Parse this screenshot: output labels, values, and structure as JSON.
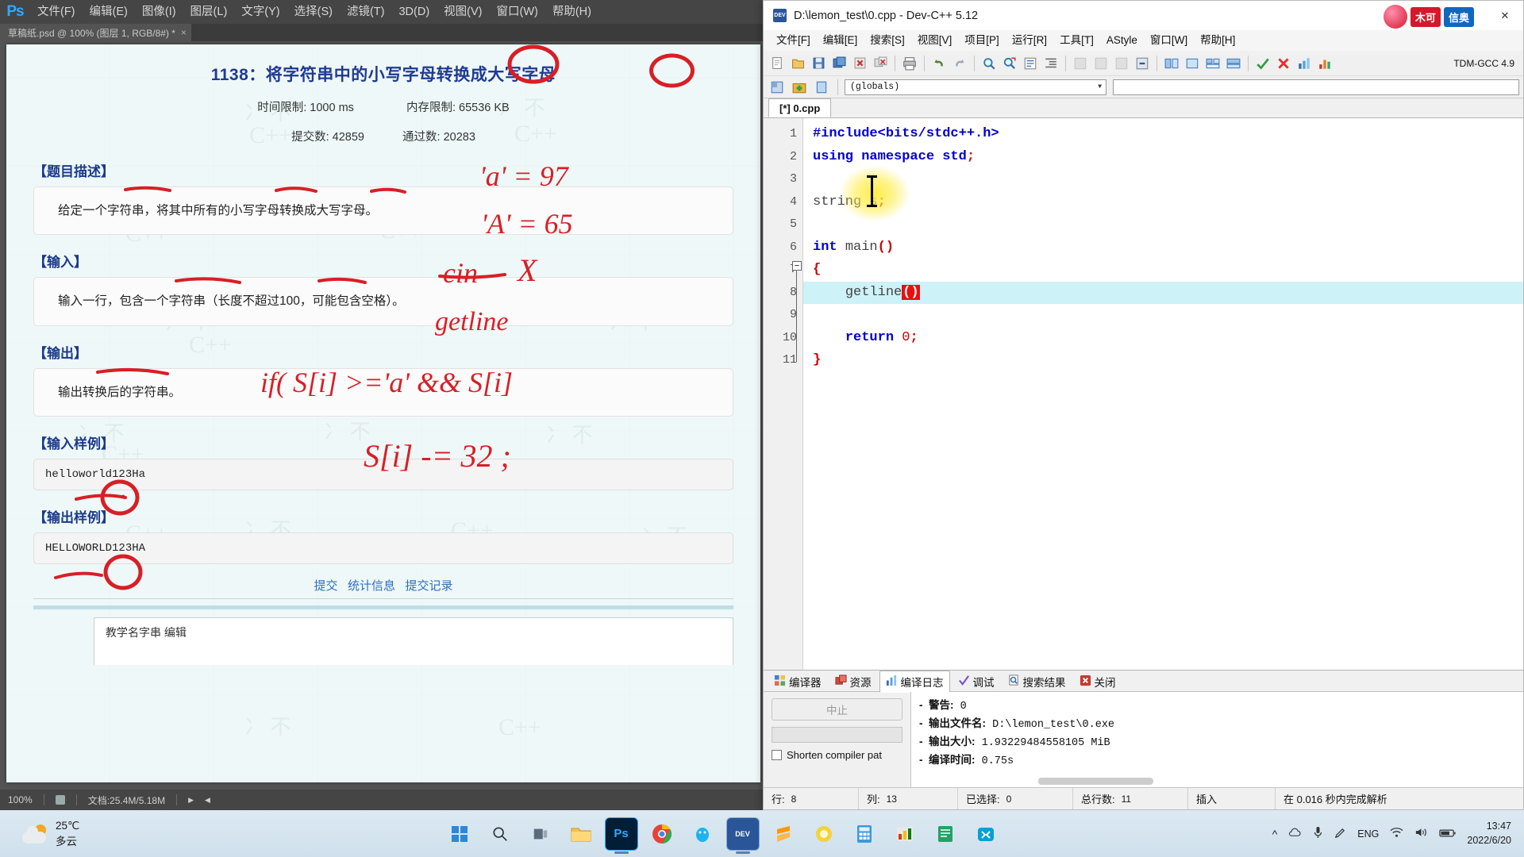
{
  "photoshop": {
    "logo": "Ps",
    "menus": [
      "文件(F)",
      "编辑(E)",
      "图像(I)",
      "图层(L)",
      "文字(Y)",
      "选择(S)",
      "滤镜(T)",
      "3D(D)",
      "视图(V)",
      "窗口(W)",
      "帮助(H)"
    ],
    "tab_title": "草稿纸.psd @ 100% (图层 1, RGB/8#) *",
    "tab_close": "×",
    "status": {
      "zoom": "100%",
      "doc_label": "文档:25.4M/5.18M",
      "play": "▶",
      "arrow": "◀"
    }
  },
  "oj": {
    "title": "1138：将字符串中的小写字母转换成大写字母",
    "time_limit": "时间限制: 1000 ms",
    "memory_limit": "内存限制: 65536 KB",
    "submit_count": "提交数: 42859",
    "pass_count": "通过数: 20283",
    "sections": [
      {
        "heading": "【题目描述】",
        "body": "给定一个字符串，将其中所有的小写字母转换成大写字母。"
      },
      {
        "heading": "【输入】",
        "body": "输入一行，包含一个字符串（长度不超过100，可能包含空格）。"
      },
      {
        "heading": "【输出】",
        "body": "输出转换后的字符串。"
      }
    ],
    "sample_input_heading": "【输入样例】",
    "sample_input": "helloworld123Ha",
    "sample_output_heading": "【输出样例】",
    "sample_output": "HELLOWORLD123HA",
    "links": [
      "提交",
      "统计信息",
      "提交记录"
    ],
    "footer_text": "教学名字串   编辑"
  },
  "ink_notes": {
    "n1": "'a' = 97",
    "n2": "'A' = 65",
    "n3": "cin  X",
    "n4": "getline",
    "n5": "if( S[i] >='a' && S[i]",
    "n6": "S[i] -= 32 ;"
  },
  "devcpp": {
    "title": "D:\\lemon_test\\0.cpp - Dev-C++ 5.12",
    "app_icon_text": "DEV",
    "window_buttons": {
      "minimize": "—",
      "maximize": "☐",
      "close": "✕"
    },
    "menus": [
      "文件[F]",
      "编辑[E]",
      "搜索[S]",
      "视图[V]",
      "项目[P]",
      "运行[R]",
      "工具[T]",
      "AStyle",
      "窗口[W]",
      "帮助[H]"
    ],
    "compiler_label": "TDM-GCC  4.9",
    "globals_value": "(globals)",
    "globals_arrow": "▼",
    "file_tab": "[*] 0.cpp",
    "code_lines": [
      {
        "n": "1",
        "text": "#include<bits/stdc++.h>"
      },
      {
        "n": "2",
        "text": "using namespace std;"
      },
      {
        "n": "3",
        "text": ""
      },
      {
        "n": "4",
        "text": "string s;"
      },
      {
        "n": "5",
        "text": ""
      },
      {
        "n": "6",
        "text": "int main()"
      },
      {
        "n": "7",
        "text": "{"
      },
      {
        "n": "8",
        "text": "    getline()"
      },
      {
        "n": "9",
        "text": ""
      },
      {
        "n": "10",
        "text": "    return 0;"
      },
      {
        "n": "11",
        "text": "}"
      }
    ],
    "bottom_tabs": [
      "编译器",
      "资源",
      "编译日志",
      "调试",
      "搜索结果",
      "关闭"
    ],
    "bottom_active_tab": "编译日志",
    "abort_button": "中止",
    "shorten_label": "Shorten compiler pat",
    "log": [
      "-  警告：0",
      "-  输出文件名：D:\\lemon_test\\0.exe",
      "-  输出大小：1.93229484558105 MiB",
      "-  编译时间：0.75s"
    ],
    "log_parts": [
      {
        "label": "-  警告:",
        "value": "0"
      },
      {
        "label": "-  输出文件名:",
        "value": "D:\\lemon_test\\0.exe"
      },
      {
        "label": "-  输出大小:",
        "value": "1.93229484558105 MiB"
      },
      {
        "label": "-  编译时间:",
        "value": "0.75s"
      }
    ],
    "status": {
      "row_label": "行:",
      "row_value": "8",
      "col_label": "列:",
      "col_value": "13",
      "sel_label": "已选择:",
      "sel_value": "0",
      "total_label": "总行数:",
      "total_value": "11",
      "mode": "插入",
      "parse": "在 0.016 秒内完成解析"
    }
  },
  "taskbar": {
    "weather_temp": "25℃",
    "weather_desc": "多云",
    "apps": [
      {
        "name": "start-button",
        "glyph": "⊞",
        "color": "#2b88d8"
      },
      {
        "name": "search-button",
        "glyph": "⌕",
        "color": "transparent"
      },
      {
        "name": "taskview-button",
        "glyph": "▭",
        "color": "transparent"
      },
      {
        "name": "explorer",
        "glyph": "📁",
        "color": "#f0c04a"
      },
      {
        "name": "photoshop",
        "glyph": "Ps",
        "color": "#001e36"
      },
      {
        "name": "chrome",
        "glyph": "◉",
        "color": "#ffffff"
      },
      {
        "name": "qq",
        "glyph": "🐧",
        "color": "#12b7f5"
      },
      {
        "name": "devcpp",
        "glyph": "DEV",
        "color": "#2a5699"
      },
      {
        "name": "sublime",
        "glyph": "S",
        "color": "#ff9800"
      },
      {
        "name": "app-yellow",
        "glyph": "●",
        "color": "#f2d02c"
      },
      {
        "name": "calculator",
        "glyph": "▤",
        "color": "#3a9ad9"
      },
      {
        "name": "office",
        "glyph": "▥",
        "color": "#d83b01"
      },
      {
        "name": "notes",
        "glyph": "▦",
        "color": "#21a366"
      },
      {
        "name": "bilibili",
        "glyph": "✕",
        "color": "#00a1d6"
      }
    ],
    "sys_icons": [
      "^",
      "☁",
      "🎤",
      "🖊"
    ],
    "ime": "ENG",
    "time": "13:47",
    "date": "2022/6/20"
  }
}
